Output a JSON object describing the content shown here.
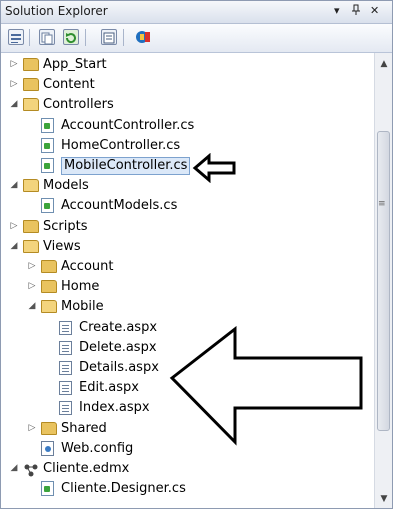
{
  "window": {
    "title": "Solution Explorer",
    "controls": [
      "▾",
      "📌",
      "✕"
    ]
  },
  "toolbar": {
    "buttons": [
      "properties-icon",
      "show-all-files-icon",
      "refresh-icon",
      "view-code-icon",
      "class-diagram-icon"
    ]
  },
  "tree": [
    {
      "label": "App_Start",
      "indent": 0,
      "expand": "collapsed",
      "icon": "folder"
    },
    {
      "label": "Content",
      "indent": 0,
      "expand": "collapsed",
      "icon": "folder"
    },
    {
      "label": "Controllers",
      "indent": 0,
      "expand": "expanded",
      "icon": "folder-open"
    },
    {
      "label": "AccountController.cs",
      "indent": 1,
      "expand": "none",
      "icon": "cs-file"
    },
    {
      "label": "HomeController.cs",
      "indent": 1,
      "expand": "none",
      "icon": "cs-file"
    },
    {
      "label": "MobileController.cs",
      "indent": 1,
      "expand": "none",
      "icon": "cs-file",
      "selected": true
    },
    {
      "label": "Models",
      "indent": 0,
      "expand": "expanded",
      "icon": "folder-open"
    },
    {
      "label": "AccountModels.cs",
      "indent": 1,
      "expand": "none",
      "icon": "cs-file"
    },
    {
      "label": "Scripts",
      "indent": 0,
      "expand": "collapsed",
      "icon": "folder"
    },
    {
      "label": "Views",
      "indent": 0,
      "expand": "expanded",
      "icon": "folder-open"
    },
    {
      "label": "Account",
      "indent": 1,
      "expand": "collapsed",
      "icon": "folder"
    },
    {
      "label": "Home",
      "indent": 1,
      "expand": "collapsed",
      "icon": "folder"
    },
    {
      "label": "Mobile",
      "indent": 1,
      "expand": "expanded",
      "icon": "folder-open"
    },
    {
      "label": "Create.aspx",
      "indent": 2,
      "expand": "none",
      "icon": "aspx-file"
    },
    {
      "label": "Delete.aspx",
      "indent": 2,
      "expand": "none",
      "icon": "aspx-file"
    },
    {
      "label": "Details.aspx",
      "indent": 2,
      "expand": "none",
      "icon": "aspx-file"
    },
    {
      "label": "Edit.aspx",
      "indent": 2,
      "expand": "none",
      "icon": "aspx-file"
    },
    {
      "label": "Index.aspx",
      "indent": 2,
      "expand": "none",
      "icon": "aspx-file"
    },
    {
      "label": "Shared",
      "indent": 1,
      "expand": "collapsed",
      "icon": "folder"
    },
    {
      "label": "Web.config",
      "indent": 1,
      "expand": "none",
      "icon": "config-file"
    },
    {
      "label": "Cliente.edmx",
      "indent": 0,
      "expand": "expanded",
      "icon": "edmx-file"
    },
    {
      "label": "Cliente.Designer.cs",
      "indent": 1,
      "expand": "none",
      "icon": "cs-file"
    }
  ],
  "scrollbar": {
    "up": "▲",
    "down": "▼",
    "grip": "≡"
  },
  "colors": {
    "selection": "#dbe8f8",
    "folder": "#e9c35f",
    "window_frame": "#cfd6e5"
  }
}
